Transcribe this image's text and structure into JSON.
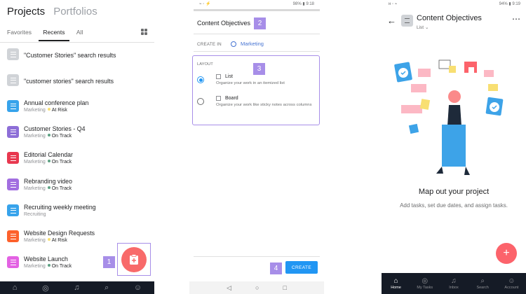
{
  "panel1": {
    "header": {
      "active": "Projects",
      "inactive": "Portfolios"
    },
    "tabs": [
      "Favorites",
      "Recents",
      "All"
    ],
    "rows": [
      {
        "title": "\"Customer Stories\" search results",
        "color": "#d0d3d7"
      },
      {
        "title": "\"customer stories\" search results",
        "color": "#d0d3d7"
      },
      {
        "title": "Annual conference plan",
        "team": "Marketing",
        "status": "At Risk",
        "status_color": "#f8df72",
        "color": "#37a3eb"
      },
      {
        "title": "Customer Stories - Q4",
        "team": "Marketing",
        "status": "On Track",
        "status_color": "#5da283",
        "color": "#8d6ed7"
      },
      {
        "title": "Editorial Calendar",
        "team": "Marketing",
        "status": "On Track",
        "status_color": "#5da283",
        "color": "#e8384f"
      },
      {
        "title": "Rebranding video",
        "team": "Marketing",
        "status": "On Track",
        "status_color": "#5da283",
        "color": "#a26ee0"
      },
      {
        "title": "Recruiting weekly meeting",
        "team": "Recruiting",
        "status": "",
        "status_color": "",
        "color": "#37a3eb"
      },
      {
        "title": "Website Design Requests",
        "team": "Marketing",
        "status": "At Risk",
        "status_color": "#f8df72",
        "color": "#fd612c"
      },
      {
        "title": "Website Launch",
        "team": "Marketing",
        "status": "On Track",
        "status_color": "#5da283",
        "color": "#e362e3"
      }
    ],
    "badge": "1",
    "fab_icon": "clipboard-plus-icon"
  },
  "panel2": {
    "status_left": "⌁ ◦ ⚡",
    "status_right": "98% ▮ 9:18",
    "title": "Content Objectives",
    "create_in": "CREATE IN",
    "team": "Marketing",
    "layout_label": "LAYOUT",
    "options": [
      {
        "name": "List",
        "desc": "Organize your work in an itemized list",
        "selected": true
      },
      {
        "name": "Board",
        "desc": "Organize your work like sticky notes across columns",
        "selected": false
      }
    ],
    "create_button": "CREATE",
    "badges": [
      "2",
      "3",
      "4"
    ]
  },
  "panel3": {
    "status_left": "ʜ ◦ ⌁",
    "status_right": "94% ▮ 9:19",
    "title": "Content Objectives",
    "subtitle": "List",
    "heading": "Map out your project",
    "desc": "Add tasks, set due dates, and assign tasks.",
    "nav": [
      "Home",
      "My Tasks",
      "Inbox",
      "Search",
      "Account"
    ]
  }
}
